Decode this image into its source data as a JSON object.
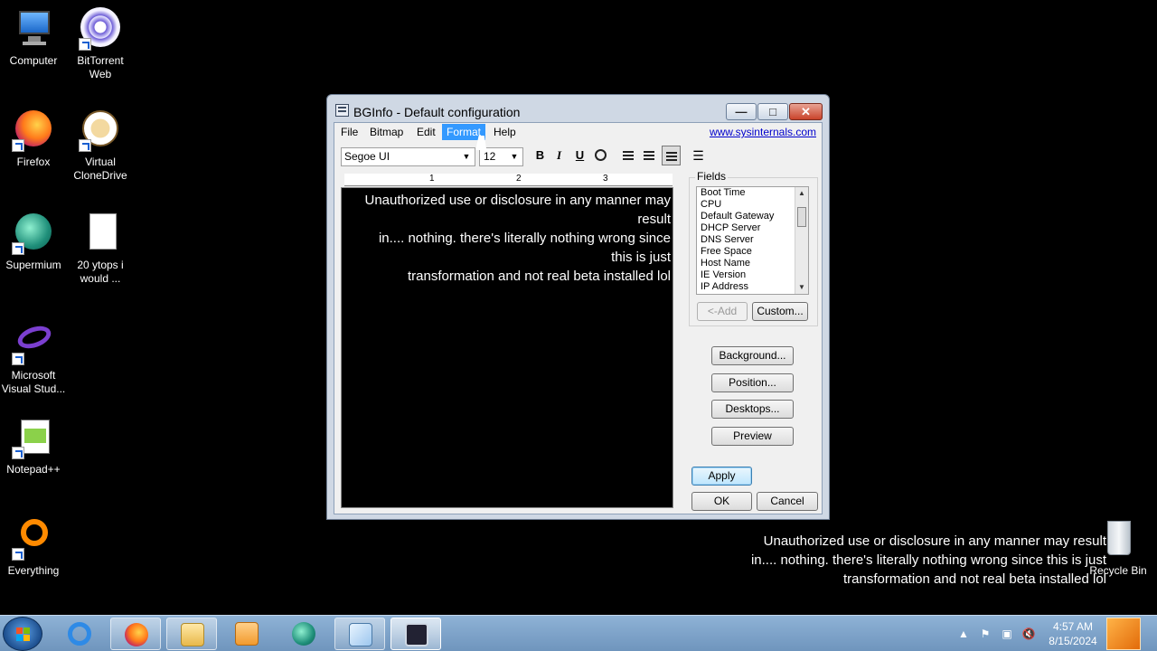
{
  "desktop": {
    "icons": [
      {
        "label": "Computer"
      },
      {
        "label": "BitTorrent\nWeb"
      },
      {
        "label": "Firefox"
      },
      {
        "label": "Virtual\nCloneDrive"
      },
      {
        "label": "Supermium"
      },
      {
        "label": "20 ytops i\nwould ..."
      },
      {
        "label": "Microsoft\nVisual Stud..."
      },
      {
        "label": "Notepad++"
      },
      {
        "label": "Everything"
      },
      {
        "label": "Recycle Bin"
      }
    ],
    "wallpaper_lines": [
      "Unauthorized use or disclosure in any manner may result",
      "in.... nothing. there's literally nothing wrong since this is just",
      "transformation and not real beta installed lol"
    ]
  },
  "window": {
    "title": "BGInfo - Default configuration",
    "controls": {
      "minimize": "—",
      "maximize": "□",
      "close": "✕"
    },
    "menu": [
      "File",
      "Bitmap",
      "Edit",
      "Format",
      "Help"
    ],
    "active_menu": "Format",
    "link": "www.sysinternals.com",
    "font_name": "Segoe UI",
    "font_size": "12",
    "format_buttons": {
      "bold": "B",
      "italic": "I",
      "underline": "U"
    },
    "ruler_numbers": [
      "1",
      "2",
      "3"
    ],
    "editor_lines": [
      "Unauthorized use or disclosure in any manner may",
      "result",
      "in.... nothing. there's literally nothing wrong since",
      "this is just",
      "transformation and not real beta installed lol"
    ],
    "fields_label": "Fields",
    "fields": [
      "Boot Time",
      "CPU",
      "Default Gateway",
      "DHCP Server",
      "DNS Server",
      "Free Space",
      "Host Name",
      "IE Version",
      "IP Address"
    ],
    "buttons": {
      "add": "<-Add",
      "custom": "Custom...",
      "background": "Background...",
      "position": "Position...",
      "desktops": "Desktops...",
      "preview": "Preview",
      "apply": "Apply",
      "ok": "OK",
      "cancel": "Cancel"
    }
  },
  "taskbar": {
    "clock_time": "4:57 AM",
    "clock_date": "8/15/2024",
    "colors": {
      "accent": "#3399ff",
      "taskbar": "#7fa5cd"
    }
  }
}
